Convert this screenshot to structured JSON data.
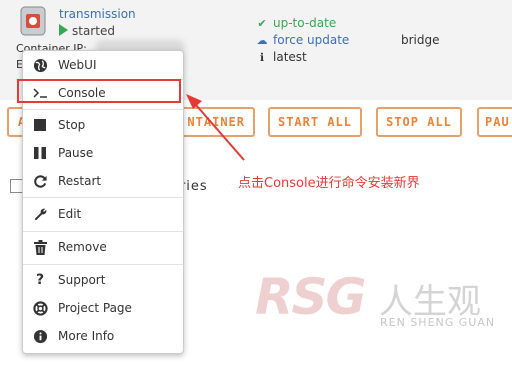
{
  "container": {
    "name": "transmission",
    "state": "started",
    "ip_label": "Container IP:",
    "e_fragment": "E"
  },
  "status": {
    "uptodate": "up-to-date",
    "force_update": "force update",
    "latest": "latest"
  },
  "network": "bridge",
  "actions": {
    "first": "A",
    "container": "NTAINER",
    "start_all": "START ALL",
    "stop_all": "STOP ALL",
    "pause": "PAU"
  },
  "tab_fragment": "ories",
  "menu": {
    "items": [
      {
        "label": "WebUI",
        "icon": "globe-icon"
      },
      {
        "label": "Console",
        "icon": "terminal-icon"
      },
      {
        "label": "Stop",
        "icon": "stop-icon"
      },
      {
        "label": "Pause",
        "icon": "pause-icon"
      },
      {
        "label": "Restart",
        "icon": "restart-icon"
      },
      {
        "label": "Edit",
        "icon": "wrench-icon"
      },
      {
        "label": "Remove",
        "icon": "trash-icon"
      },
      {
        "label": "Support",
        "icon": "question-icon"
      },
      {
        "label": "Project Page",
        "icon": "lifebuoy-icon"
      },
      {
        "label": "More Info",
        "icon": "info-icon"
      }
    ]
  },
  "annotation": {
    "text": "点击Console进行命令安装新界",
    "color": "#e53935"
  },
  "watermark": {
    "logo": "RSG",
    "cn": "人生观",
    "en": "REN SHENG GUAN"
  },
  "colors": {
    "accent_orange": "#e8833a",
    "link_blue": "#3b6fb6",
    "ok_green": "#34a853",
    "highlight_red": "#e53935"
  }
}
